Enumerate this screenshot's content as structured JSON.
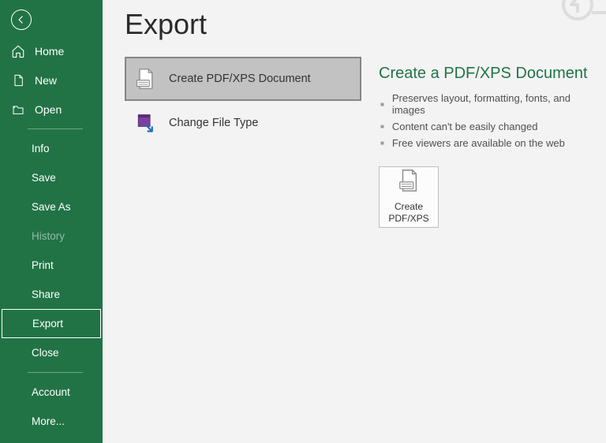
{
  "sidebar": {
    "items": {
      "home": {
        "label": "Home"
      },
      "new": {
        "label": "New"
      },
      "open": {
        "label": "Open"
      },
      "info": {
        "label": "Info"
      },
      "save": {
        "label": "Save"
      },
      "saveas": {
        "label": "Save As"
      },
      "history": {
        "label": "History"
      },
      "print": {
        "label": "Print"
      },
      "share": {
        "label": "Share"
      },
      "export": {
        "label": "Export"
      },
      "close": {
        "label": "Close"
      },
      "account": {
        "label": "Account"
      },
      "more": {
        "label": "More..."
      }
    }
  },
  "main": {
    "title": "Export",
    "options": {
      "pdf": {
        "label": "Create PDF/XPS Document"
      },
      "type": {
        "label": "Change File Type"
      }
    },
    "detail": {
      "title": "Create a PDF/XPS Document",
      "bullets": [
        "Preserves layout, formatting, fonts, and images",
        "Content can't be easily changed",
        "Free viewers are available on the web"
      ],
      "button": {
        "line1": "Create",
        "line2": "PDF/XPS"
      }
    }
  },
  "colors": {
    "accent": "#217346"
  }
}
